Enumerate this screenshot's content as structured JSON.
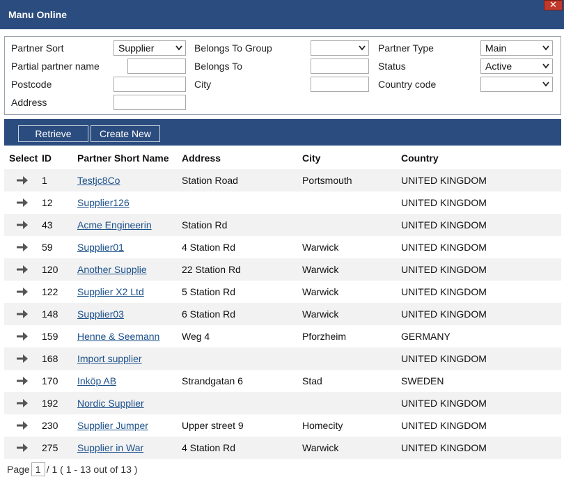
{
  "window": {
    "title": "Manu Online",
    "close_symbol": "✕"
  },
  "filters": {
    "partner_sort": {
      "label": "Partner Sort",
      "value": "Supplier"
    },
    "partial_partner_name": {
      "label": "Partial partner name",
      "value": ""
    },
    "postcode": {
      "label": "Postcode",
      "value": ""
    },
    "address": {
      "label": "Address",
      "value": ""
    },
    "belongs_to_group": {
      "label": "Belongs To Group",
      "value": ""
    },
    "belongs_to": {
      "label": "Belongs To",
      "value": ""
    },
    "city": {
      "label": "City",
      "value": ""
    },
    "partner_type": {
      "label": "Partner Type",
      "value": "Main"
    },
    "status": {
      "label": "Status",
      "value": "Active"
    },
    "country_code": {
      "label": "Country code",
      "value": ""
    }
  },
  "toolbar": {
    "retrieve_label": "Retrieve",
    "create_new_label": "Create New"
  },
  "grid": {
    "headers": {
      "select": "Select",
      "id": "ID",
      "name": "Partner Short Name",
      "address": "Address",
      "city": "City",
      "country": "Country"
    },
    "rows": [
      {
        "id": "1",
        "name": "Testjc8Co",
        "address": "Station Road",
        "city": "Portsmouth",
        "country": "UNITED KINGDOM"
      },
      {
        "id": "12",
        "name": "Supplier126",
        "address": "",
        "city": "",
        "country": "UNITED KINGDOM"
      },
      {
        "id": "43",
        "name": "Acme Engineerin",
        "address": "Station Rd",
        "city": "",
        "country": "UNITED KINGDOM"
      },
      {
        "id": "59",
        "name": "Supplier01",
        "address": "4 Station Rd",
        "city": "Warwick",
        "country": "UNITED KINGDOM"
      },
      {
        "id": "120",
        "name": "Another Supplie",
        "address": "22 Station Rd",
        "city": "Warwick",
        "country": "UNITED KINGDOM"
      },
      {
        "id": "122",
        "name": "Supplier X2 Ltd",
        "address": "5 Station Rd",
        "city": "Warwick",
        "country": "UNITED KINGDOM"
      },
      {
        "id": "148",
        "name": "Supplier03",
        "address": "6 Station Rd",
        "city": "Warwick",
        "country": "UNITED KINGDOM"
      },
      {
        "id": "159",
        "name": "Henne & Seemann",
        "address": "Weg 4",
        "city": "Pforzheim",
        "country": "GERMANY"
      },
      {
        "id": "168",
        "name": "Import supplier",
        "address": "",
        "city": "",
        "country": "UNITED KINGDOM"
      },
      {
        "id": "170",
        "name": "Inköp AB",
        "address": "Strandgatan 6",
        "city": "Stad",
        "country": "SWEDEN"
      },
      {
        "id": "192",
        "name": "Nordic Supplier",
        "address": "",
        "city": "",
        "country": "UNITED KINGDOM"
      },
      {
        "id": "230",
        "name": "Supplier Jumper",
        "address": "Upper street 9",
        "city": "Homecity",
        "country": "UNITED KINGDOM"
      },
      {
        "id": "275",
        "name": "Supplier in War",
        "address": "4 Station Rd",
        "city": "Warwick",
        "country": "UNITED KINGDOM"
      }
    ]
  },
  "pager": {
    "label": "Page",
    "current": "1",
    "total": "/ 1",
    "summary": "( 1 - 13 out of 13 )"
  },
  "colors": {
    "header_bar": "#2b4c7e",
    "link": "#1a4f8a",
    "row_alt": "#f2f2f2"
  },
  "icons": {
    "row_select": "arrow-right-icon",
    "dropdown": "chevron-down-icon",
    "close": "close-icon"
  }
}
